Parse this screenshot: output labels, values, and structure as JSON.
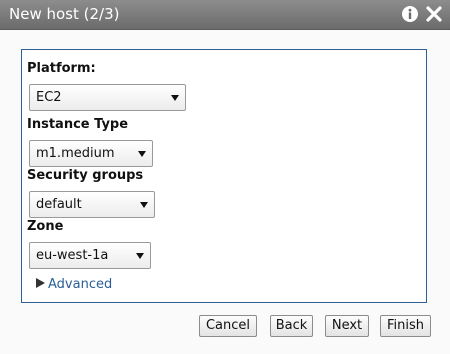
{
  "window": {
    "title": "New host (2/3)",
    "icons": {
      "info": "info-icon",
      "close": "close-icon"
    }
  },
  "form": {
    "platform": {
      "label": "Platform:",
      "value": "EC2"
    },
    "instance_type": {
      "label": "Instance Type",
      "value": "m1.medium"
    },
    "security_groups": {
      "label": "Security groups",
      "value": "default"
    },
    "zone": {
      "label": "Zone",
      "value": "eu-west-1a"
    },
    "advanced": {
      "label": "Advanced"
    }
  },
  "buttons": {
    "cancel": "Cancel",
    "back": "Back",
    "next": "Next",
    "finish": "Finish"
  },
  "colors": {
    "titlebar": "#7a7a7a",
    "panel_border": "#2c5f96",
    "link": "#2b5f96"
  }
}
